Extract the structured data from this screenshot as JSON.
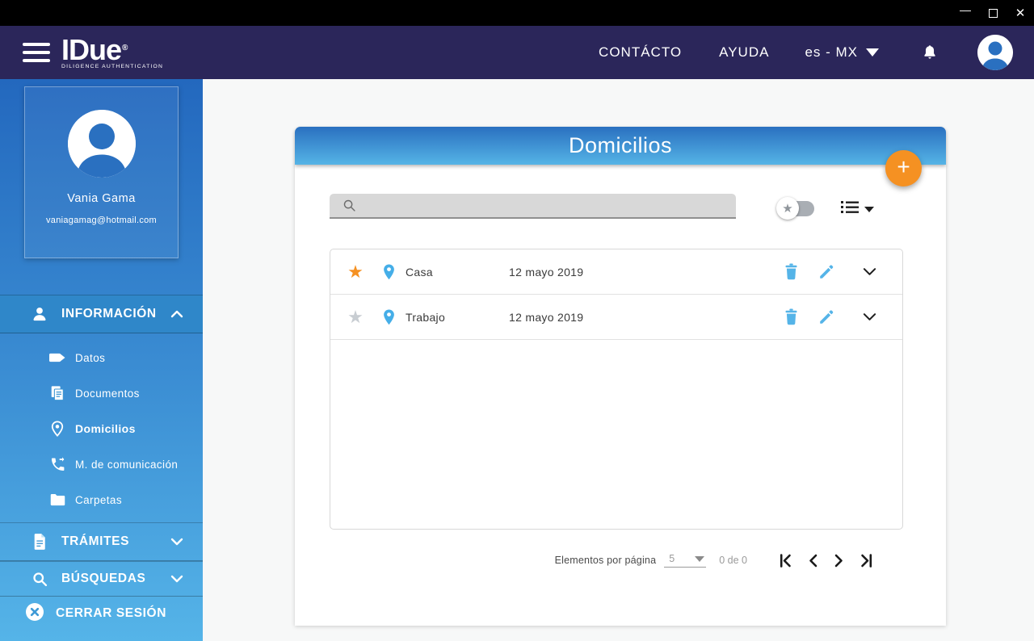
{
  "window": {
    "controls": {
      "minimize": "minimize",
      "maximize": "maximize",
      "close": "✕",
      "minimize_glyph": "—"
    }
  },
  "header": {
    "logo": {
      "brand": "IDue",
      "registered": "®",
      "tagline": "DILIGENCE AUTHENTICATION"
    },
    "nav": [
      {
        "label": "CONTÁCTO"
      },
      {
        "label": "AYUDA"
      }
    ],
    "language": {
      "value": "es - MX"
    },
    "icons": {
      "bell": "notifications",
      "avatar": "user-avatar"
    }
  },
  "sidebar": {
    "profile": {
      "name": "Vania Gama",
      "email": "vaniagamag@hotmail.com"
    },
    "sections": [
      {
        "label": "INFORMACIÓN",
        "expanded": true,
        "items": [
          {
            "label": "Datos",
            "active": false
          },
          {
            "label": "Documentos",
            "active": false
          },
          {
            "label": "Domicilios",
            "active": true
          },
          {
            "label": "M. de comunicación",
            "active": false
          },
          {
            "label": "Carpetas",
            "active": false
          }
        ]
      },
      {
        "label": "TRÁMITES",
        "expanded": false
      },
      {
        "label": "BÚSQUEDAS",
        "expanded": false
      }
    ],
    "logout": {
      "label": "CERRAR SESIÓN"
    }
  },
  "main": {
    "title": "Domicilios",
    "add_button": "+",
    "search": {
      "value": ""
    },
    "filters": {
      "favorites_toggle": "off",
      "view_selector": "list"
    },
    "rows": [
      {
        "name": "Casa",
        "date": "12 mayo 2019",
        "favorite": true
      },
      {
        "name": "Trabajo",
        "date": "12 mayo 2019",
        "favorite": false
      }
    ],
    "pagination": {
      "label": "Elementos por página",
      "page_size": "5",
      "range": "0 de 0"
    }
  },
  "colors": {
    "header_navy": "#2b265a",
    "sidebar_top": "#2368be",
    "sidebar_bottom": "#55b4e8",
    "section_active": "#2f87c9",
    "card_gradient_top": "#2a70c0",
    "card_gradient_bottom": "#55b4e6",
    "accent_orange": "#f59122",
    "icon_blue": "#55b4e8",
    "star_gray": "#c8cdd2",
    "content_bg": "#f7f8f8"
  }
}
